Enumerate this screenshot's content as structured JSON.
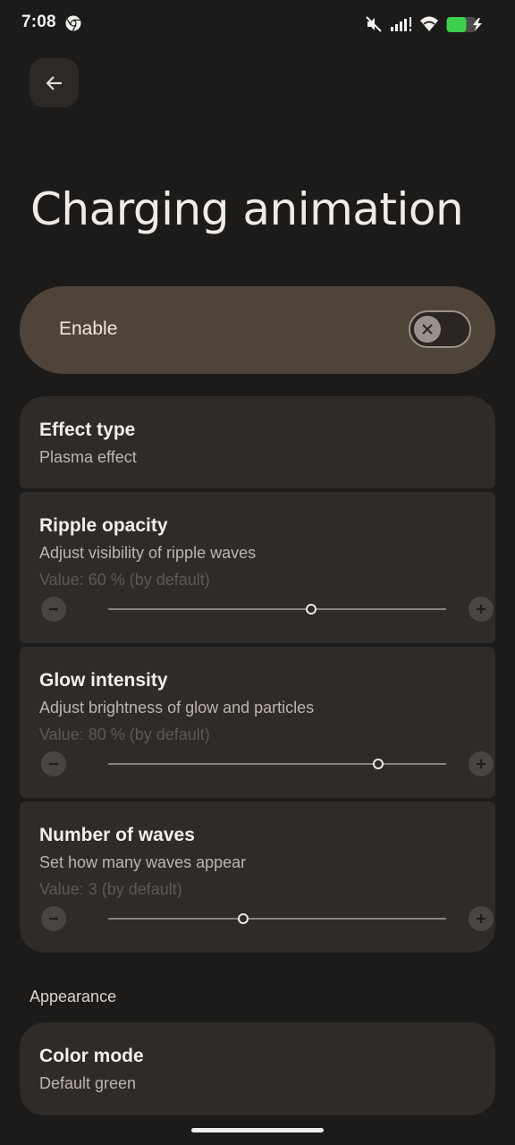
{
  "status_bar": {
    "time": "7:08",
    "app_icon": "chrome-icon",
    "icons": [
      "mute-icon",
      "signal-icon",
      "wifi-icon",
      "battery-charging-icon"
    ],
    "battery_color": "#3ccf4e"
  },
  "header": {
    "back_icon": "arrow-back-icon",
    "title": "Charging animation"
  },
  "enable": {
    "label": "Enable",
    "toggle_on": false
  },
  "settings": {
    "effect_type": {
      "title": "Effect type",
      "subtitle": "Plasma effect"
    },
    "ripple_opacity": {
      "title": "Ripple opacity",
      "subtitle": "Adjust visibility of ripple waves",
      "value_text": "Value: 60 % (by default)",
      "level": 0.6
    },
    "glow_intensity": {
      "title": "Glow intensity",
      "subtitle": "Adjust brightness of glow and particles",
      "value_text": "Value: 80 % (by default)",
      "level": 0.8
    },
    "number_of_waves": {
      "title": "Number of waves",
      "subtitle": "Set how many waves appear",
      "value_text": "Value: 3  (by default)",
      "level": 0.4
    }
  },
  "appearance": {
    "section_label": "Appearance",
    "color_mode": {
      "title": "Color mode",
      "subtitle": "Default green"
    }
  },
  "colors": {
    "background": "#1c1b1a",
    "enable_card": "#4f443a",
    "card": "#2f2b28"
  }
}
